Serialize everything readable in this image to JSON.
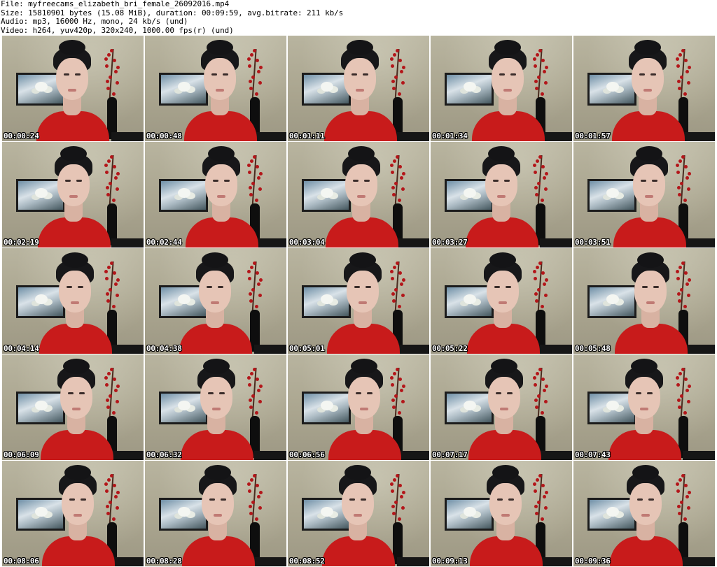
{
  "header": {
    "file_line": "File: myfreecams_elizabeth_bri_female_26092016.mp4",
    "size_line": "Size: 15810901 bytes (15.08 MiB), duration: 00:09:59, avg.bitrate: 211 kb/s",
    "audio_line": "Audio: mp3, 16000 Hz, mono, 24 kb/s (und)",
    "video_line": "Video: h264, yuv420p, 320x240, 1000.00 fps(r) (und)"
  },
  "grid": {
    "columns": 5,
    "rows": 5,
    "thumbnails": [
      {
        "timestamp": "00:00:24"
      },
      {
        "timestamp": "00:00:48"
      },
      {
        "timestamp": "00:01:11"
      },
      {
        "timestamp": "00:01:34"
      },
      {
        "timestamp": "00:01:57"
      },
      {
        "timestamp": "00:02:19"
      },
      {
        "timestamp": "00:02:44"
      },
      {
        "timestamp": "00:03:04"
      },
      {
        "timestamp": "00:03:27"
      },
      {
        "timestamp": "00:03:51"
      },
      {
        "timestamp": "00:04:14"
      },
      {
        "timestamp": "00:04:38"
      },
      {
        "timestamp": "00:05:01"
      },
      {
        "timestamp": "00:05:22"
      },
      {
        "timestamp": "00:05:48"
      },
      {
        "timestamp": "00:06:09"
      },
      {
        "timestamp": "00:06:32"
      },
      {
        "timestamp": "00:06:56"
      },
      {
        "timestamp": "00:07:17"
      },
      {
        "timestamp": "00:07:43"
      },
      {
        "timestamp": "00:08:06"
      },
      {
        "timestamp": "00:08:28"
      },
      {
        "timestamp": "00:08:52"
      },
      {
        "timestamp": "00:09:13"
      },
      {
        "timestamp": "00:09:36"
      }
    ]
  },
  "colors": {
    "shirt": "#c81b1b",
    "wall": "#b0ab95",
    "timestamp_text": "#ffffff",
    "timestamp_outline": "#000000"
  }
}
